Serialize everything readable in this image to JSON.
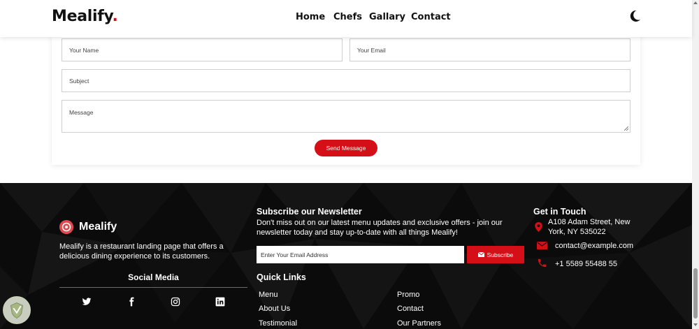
{
  "header": {
    "brand": "Mealify",
    "brand_dot": ".",
    "nav": [
      "Home",
      "Chefs",
      "Gallary",
      "Contact"
    ],
    "theme_icon": "moon-icon"
  },
  "contact_form": {
    "name_placeholder": "Your Name",
    "email_placeholder": "Your Email",
    "subject_placeholder": "Subject",
    "message_placeholder": "Message",
    "send_label": "Send Message"
  },
  "footer": {
    "logo_text": "Mealify",
    "description": "Mealify is a restaurant landing page that offers a delicious dining experience to its customers.",
    "social_title": "Social Media",
    "social_icons": [
      "twitter-icon",
      "facebook-icon",
      "instagram-icon",
      "linkedin-icon"
    ],
    "newsletter_title": "Subscribe our Newsletter",
    "newsletter_desc": "Don't miss out on our latest menu updates and exclusive offers - join our newsletter today and stay up-to-date with all things Mealify!",
    "email_placeholder": "Enter Your Email Address",
    "subscribe_label": "Subscribe",
    "quick_links_title": "Quick Links",
    "quick_links": [
      "Menu",
      "Promo",
      "About Us",
      "Contact",
      "Testimonial",
      "Our Partners"
    ],
    "get_in_touch_title": "Get in Touch",
    "address": "A108 Adam Street, New York, NY 535022",
    "email": "contact@example.com",
    "phone": "+1 5589 55488 55"
  },
  "colors": {
    "accent": "#d40f17",
    "footer_bg": "#0b0b0b",
    "logo_circle": "#e0474f"
  }
}
